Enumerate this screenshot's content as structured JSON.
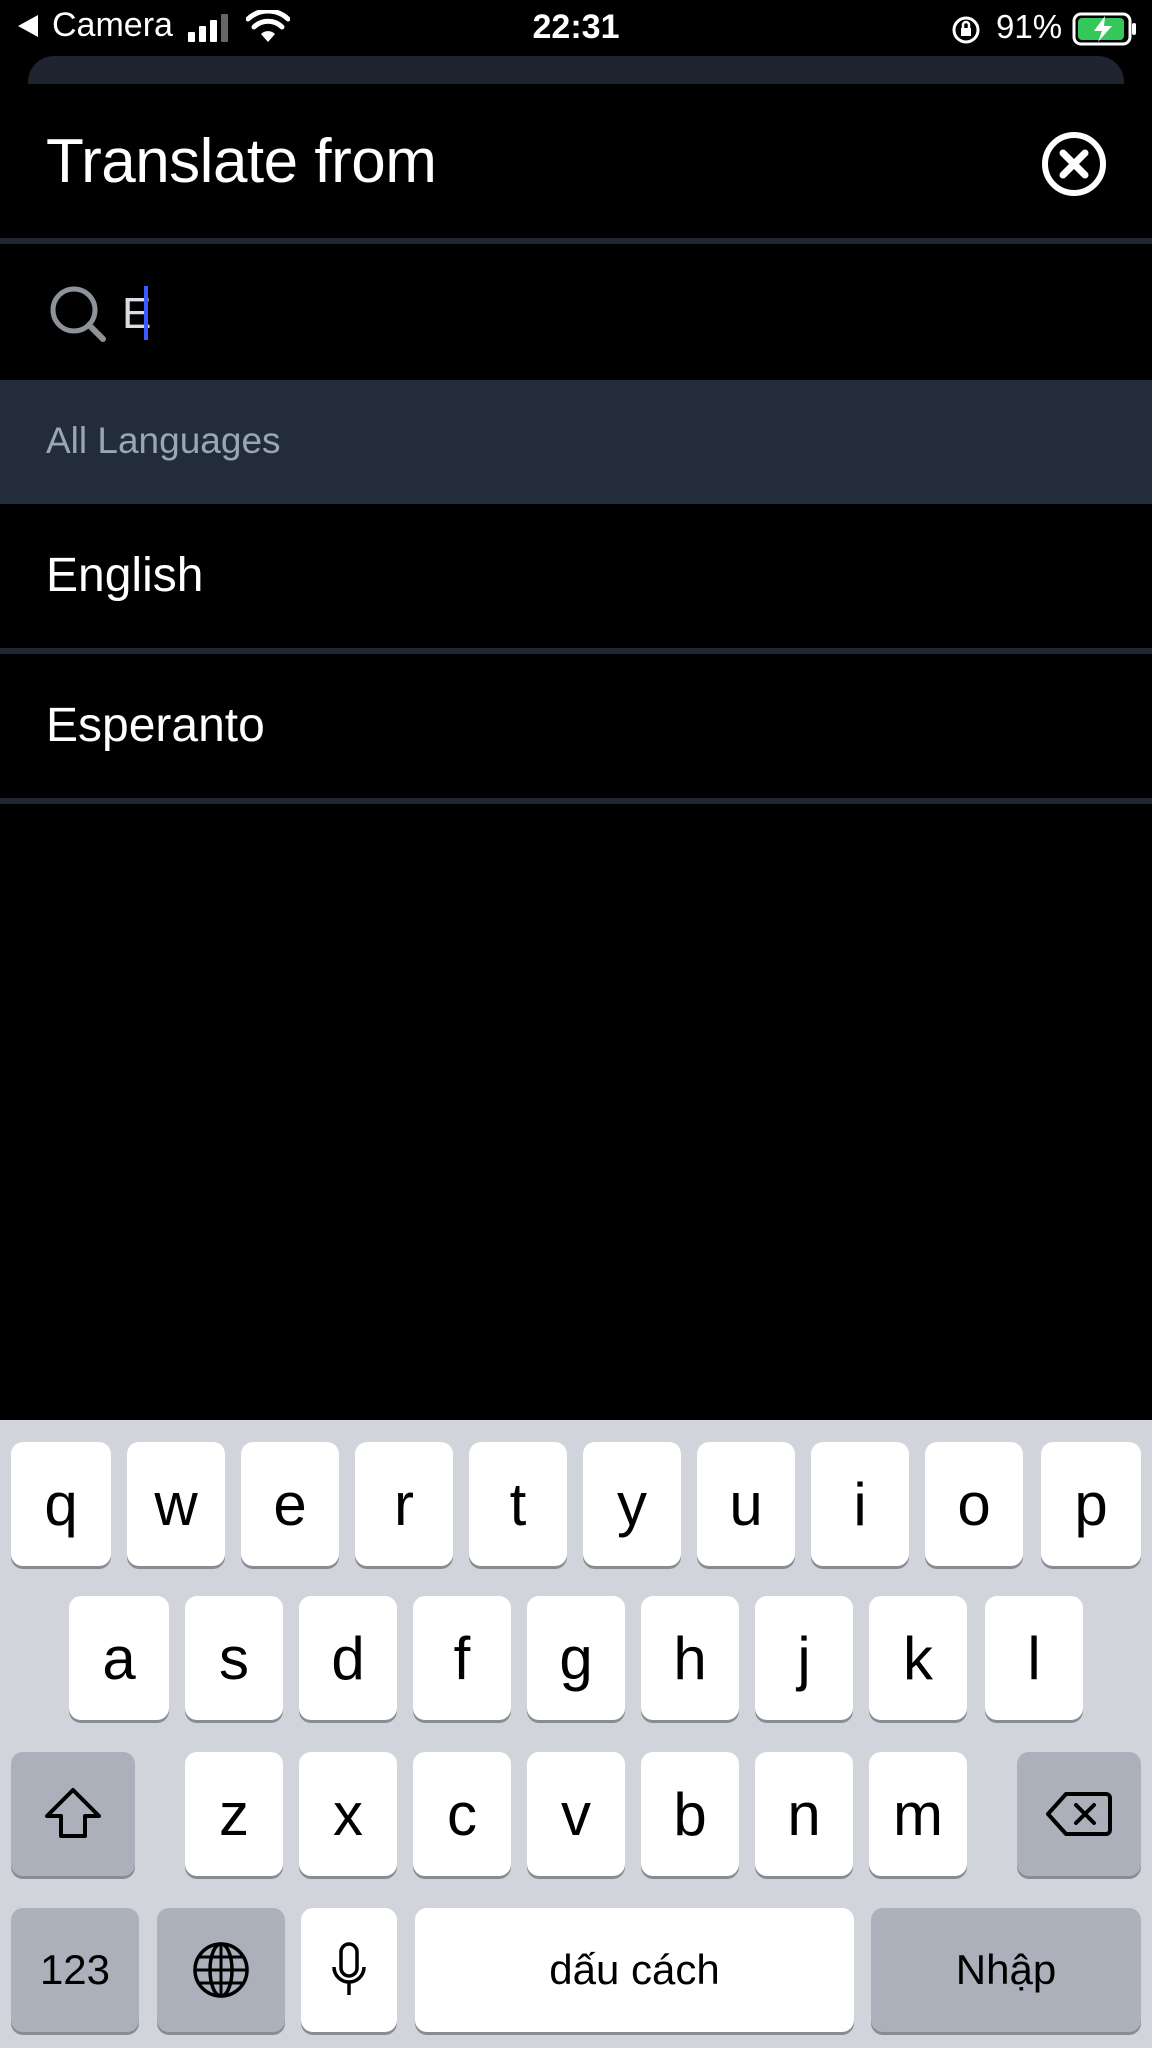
{
  "status_bar": {
    "back_label": "Camera",
    "time": "22:31",
    "battery_percent": "91%"
  },
  "sheet": {
    "title": "Translate from"
  },
  "search": {
    "value": "E",
    "placeholder": ""
  },
  "section": {
    "header": "All Languages"
  },
  "languages": [
    {
      "label": "English"
    },
    {
      "label": "Esperanto"
    }
  ],
  "keyboard": {
    "row1": [
      "q",
      "w",
      "e",
      "r",
      "t",
      "y",
      "u",
      "i",
      "o",
      "p"
    ],
    "row2": [
      "a",
      "s",
      "d",
      "f",
      "g",
      "h",
      "j",
      "k",
      "l"
    ],
    "row3": [
      "z",
      "x",
      "c",
      "v",
      "b",
      "n",
      "m"
    ],
    "numbers_label": "123",
    "space_label": "dấu cách",
    "return_label": "Nhập"
  },
  "colors": {
    "background": "#000000",
    "section_header_bg": "#232c3b",
    "divider": "#1f2733",
    "caret": "#3a5bff",
    "keyboard_bg": "#d1d4da",
    "battery_fill": "#34c759"
  }
}
